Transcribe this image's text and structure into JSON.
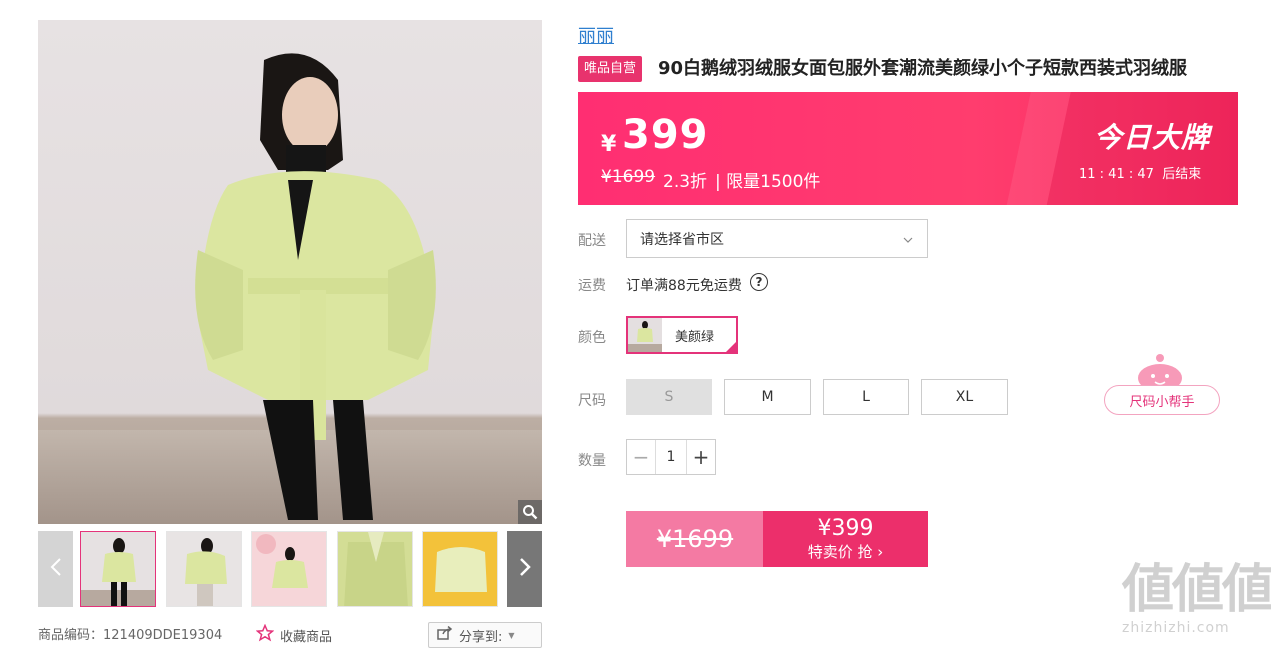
{
  "gallery": {
    "zoom_icon": "magnifier-icon",
    "prev_icon": "chevron-left-icon",
    "next_icon": "chevron-right-icon",
    "thumbnails": [
      "model-front",
      "model-turned",
      "model-pink-bg",
      "jacket-closeup",
      "jacket-flatlay"
    ]
  },
  "meta": {
    "sku_label": "商品编码：",
    "sku_value": "121409DDE19304",
    "favorite_label": "收藏商品",
    "share_label": "分享到:"
  },
  "product": {
    "brand": "丽丽",
    "badge": "唯品自营",
    "title": "90白鹅绒羽绒服女面包服外套潮流美颜绿小个子短款西装式羽绒服"
  },
  "price_banner": {
    "currency": "¥",
    "price": "399",
    "original_price": "¥1699",
    "discount": "2.3折",
    "separator": "|",
    "limit": "限量1500件",
    "event_name": "今日大牌",
    "countdown": "11 : 41 : 47",
    "countdown_suffix": "后结束",
    "colors": {
      "start": "#ff2e72",
      "end": "#f6285e"
    }
  },
  "delivery": {
    "label": "配送",
    "placeholder": "请选择省市区"
  },
  "shipping": {
    "label": "运费",
    "text": "订单满88元免运费",
    "help": "?"
  },
  "color": {
    "label": "颜色",
    "selected": "美颜绿"
  },
  "size": {
    "label": "尺码",
    "options": [
      "S",
      "M",
      "L",
      "XL"
    ],
    "helper": "尺码小帮手"
  },
  "quantity": {
    "label": "数量",
    "minus": "−",
    "value": "1",
    "plus": "+"
  },
  "buy": {
    "original": "¥1699",
    "price": "¥399",
    "action": "特卖价 抢 ›",
    "accent": "#ec2f6b"
  },
  "watermark": {
    "glyphs": "値値値",
    "site": "zhizhizhi.com"
  }
}
